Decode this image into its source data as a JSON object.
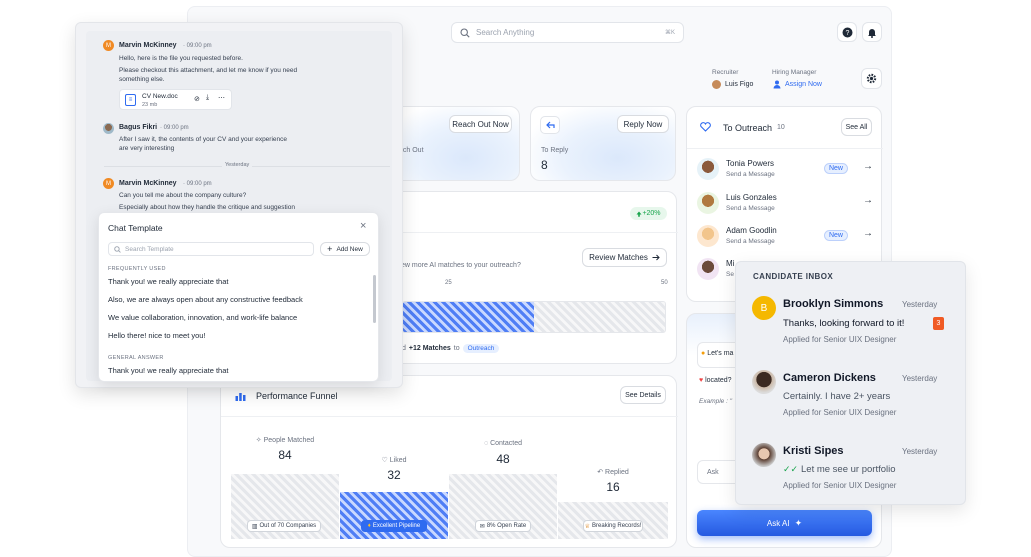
{
  "search": {
    "placeholder": "Search Anything",
    "shortcut": "⌘K"
  },
  "header": {
    "recruiter_label": "Recruiter",
    "recruiter_name": "Luis Figo",
    "hiring_manager_label": "Hiring Manager",
    "assign_now": "Assign Now"
  },
  "chat": {
    "messages": [
      {
        "author": "Marvin McKinney",
        "time": "· 09:00 pm",
        "lines": [
          "Hello, here is the file you requested before.",
          "Please checkout this attachment, and let me know if you need",
          "something else."
        ]
      },
      {
        "author": "Bagus Fikri",
        "time": "· 09:00 pm",
        "lines": [
          "After I saw it, the contents of your CV and your experience",
          "are very interesting"
        ]
      },
      {
        "author": "Marvin McKinney",
        "time": "· 09:00 pm",
        "lines": [
          "Can you tell me about the company culture?",
          "Especially about how they handle the critique and suggestion"
        ]
      }
    ],
    "attachment": {
      "name": "CV New.doc",
      "size": "23 mb"
    },
    "divider": "Yesterday"
  },
  "template": {
    "title": "Chat Template",
    "search_placeholder": "Search Template",
    "add_new": "Add New",
    "frequently_used_label": "FREQUENTLY USED",
    "frequently_used": [
      "Thank you! we really appreciate that",
      "Also, we are always open about any constructive feedback",
      "We value collaboration, innovation, and work-life balance",
      "Hello there! nice to meet you!"
    ],
    "general_answer_label": "GENERAL ANSWER",
    "general_answer": [
      "Thank you! we really appreciate that"
    ]
  },
  "stats": {
    "reach_out_now": "Reach Out Now",
    "reach_out_partial": "ach Out",
    "reply_now": "Reply Now",
    "to_reply_label": "To Reply",
    "to_reply_value": "8",
    "growth": "+20%"
  },
  "matches": {
    "prompt": "ew more AI matches to your outreach?",
    "review": "Review Matches",
    "ticks": [
      "25",
      "50"
    ],
    "footer_pre": "d",
    "footer_bold": "+12 Matches",
    "footer_to": "to",
    "outreach_tag": "Outreach"
  },
  "outreach": {
    "title": "To Outreach",
    "count": "10",
    "see_all": "See All",
    "people": [
      {
        "name": "Tonia Powers",
        "sub": "Send a Message",
        "badge": "New"
      },
      {
        "name": "Luis Gonzales",
        "sub": "Send a Message",
        "badge": ""
      },
      {
        "name": "Adam Goodlin",
        "sub": "Send a Message",
        "badge": "New"
      },
      {
        "name": "Mi",
        "sub": "Se",
        "badge": ""
      }
    ]
  },
  "inbox": {
    "title": "CANDIDATE INBOX",
    "items": [
      {
        "name": "Brooklyn Simmons",
        "day": "Yesterday",
        "message": "Thanks, looking forward to it!",
        "unread": "3",
        "applied": "Applied for Senior UIX Designer",
        "initial": "B"
      },
      {
        "name": "Cameron Dickens",
        "day": "Yesterday",
        "message": "Certainly. I have 2+ years",
        "unread": "",
        "applied": "Applied for Senior UIX Designer",
        "initial": ""
      },
      {
        "name": "Kristi Sipes",
        "day": "Yesterday",
        "message": "Let me see ur portfolio",
        "unread": "",
        "applied": "Applied for Senior UIX Designer",
        "initial": ""
      }
    ]
  },
  "ai": {
    "lets": "Let's ma",
    "located": "located?",
    "example": "Example : \"",
    "ask_partial": "Ask",
    "ask_ai": "Ask AI"
  },
  "funnel": {
    "title": "Performance Funnel",
    "see_details": "See Details",
    "stages": [
      {
        "label": "People Matched",
        "value": "84",
        "chip": "Out of 70 Companies"
      },
      {
        "label": "Liked",
        "value": "32",
        "chip": "Excellent Pipeline"
      },
      {
        "label": "Contacted",
        "value": "48",
        "chip": "8% Open Rate"
      },
      {
        "label": "Replied",
        "value": "16",
        "chip": "Breaking Records!"
      }
    ]
  },
  "colors": {
    "accent": "#2f6bf0",
    "orange": "#f08a24",
    "green": "#16a34a"
  }
}
